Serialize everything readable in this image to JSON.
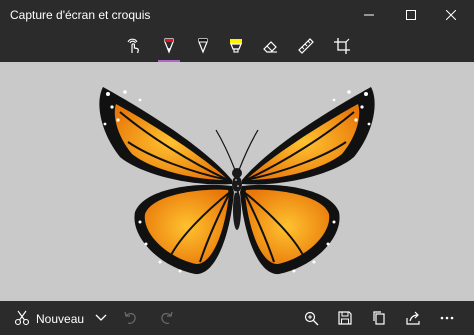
{
  "window": {
    "title": "Capture d'écran et croquis",
    "controls": [
      "minimize-icon",
      "maximize-icon",
      "close-icon"
    ]
  },
  "toolbar": {
    "tools": [
      {
        "name": "touch-writing",
        "icon": "touch-writing-icon"
      },
      {
        "name": "ballpoint-pen",
        "icon": "ballpoint-pen-icon",
        "selected": true,
        "color": "#e81123"
      },
      {
        "name": "pencil",
        "icon": "pencil-icon"
      },
      {
        "name": "highlighter",
        "icon": "highlighter-icon",
        "color": "#fff100"
      },
      {
        "name": "eraser",
        "icon": "eraser-icon"
      },
      {
        "name": "ruler",
        "icon": "ruler-icon"
      },
      {
        "name": "crop",
        "icon": "crop-icon"
      }
    ],
    "accent_color": "#b067c9"
  },
  "canvas": {
    "background": "#c9c9c9",
    "image": "monarch-butterfly"
  },
  "bottombar": {
    "new_label": "Nouveau",
    "icons": [
      "new-snip-icon",
      "dropdown-chevron-icon",
      "undo-icon",
      "redo-icon",
      "zoom-icon",
      "save-icon",
      "copy-icon",
      "share-icon",
      "more-icon"
    ]
  }
}
